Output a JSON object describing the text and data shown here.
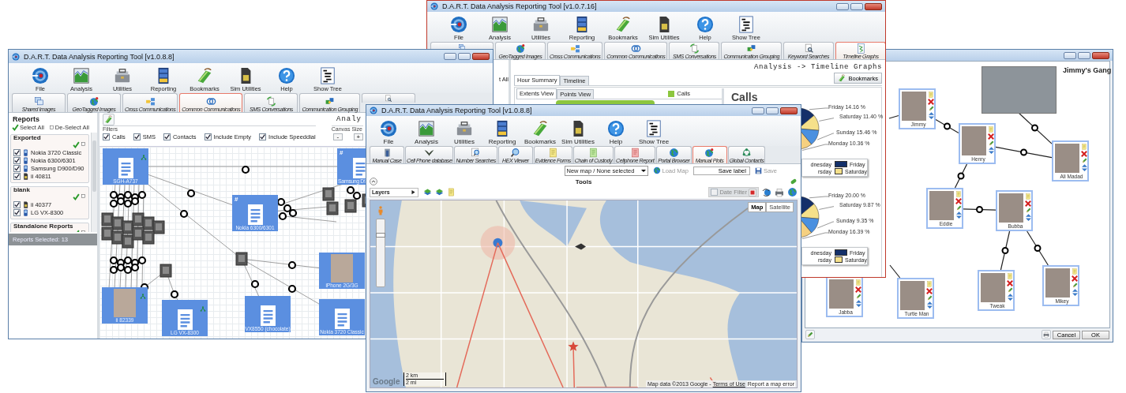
{
  "graph_window": {
    "title": "D.A.R.T. Data Analysis Reporting Tool [v1.0.8.8]",
    "toolbar": [
      "File",
      "Analysis",
      "Utilities",
      "Reporting",
      "Bookmarks",
      "Sim Utilities",
      "Help",
      "Show Tree"
    ],
    "tabs": [
      {
        "label": "Shared Images",
        "selected": false
      },
      {
        "label": "GeoTagged Images",
        "selected": false
      },
      {
        "label": "Cross Communications",
        "selected": false
      },
      {
        "label": "Common Communications",
        "selected": true
      },
      {
        "label": "SMS Conversations",
        "selected": false
      },
      {
        "label": "Communication Grouping",
        "selected": false
      },
      {
        "selected": false
      }
    ],
    "reports": {
      "title": "Reports",
      "select_all": "Select All",
      "deselect_all": "De-Select All",
      "groups": [
        {
          "name": "Exported",
          "items": [
            {
              "label": "Nokia 3720 Classic",
              "checked": true,
              "kind": "phone"
            },
            {
              "label": "Nokia 6300/6301",
              "checked": true,
              "kind": "phone"
            },
            {
              "label": "Samsung D900/D90",
              "checked": true,
              "kind": "phone"
            },
            {
              "label": "ii 40811",
              "checked": true,
              "kind": "sim"
            }
          ]
        },
        {
          "name": "blank",
          "items": [
            {
              "label": "ii 40377",
              "checked": true,
              "kind": "sim"
            },
            {
              "label": "LG VX-8300",
              "checked": true,
              "kind": "phone"
            }
          ]
        },
        {
          "name": "Standalone Reports"
        }
      ],
      "status": "Reports Selected: 13"
    },
    "breadcrumb": "Analy",
    "filters": {
      "title": "Filters",
      "items": [
        {
          "label": "Calls",
          "checked": true
        },
        {
          "label": "SMS",
          "checked": true
        },
        {
          "label": "Contacts",
          "checked": true
        },
        {
          "label": "Include Empty",
          "checked": true
        },
        {
          "label": "Include Speeddial",
          "checked": true
        }
      ]
    },
    "canvas_size": {
      "title": "Canvas Size",
      "buttons": [
        "-",
        "+"
      ]
    },
    "nodes": [
      {
        "label": "SGH-A737",
        "kind": "document",
        "tagged": true
      },
      {
        "label": "Nokia 6300/6301",
        "kind": "document",
        "mark": "#",
        "tagged": false
      },
      {
        "label": "Samsung D9",
        "kind": "document",
        "mark": "#",
        "tagged": false
      },
      {
        "label": "iPhone 2G/3G",
        "kind": "photo",
        "tagged": false
      },
      {
        "label": "ii 82339",
        "kind": "photo",
        "tagged": true
      },
      {
        "label": "LG VX-8300",
        "kind": "document",
        "tagged": true
      },
      {
        "label": "VX8550 (chocolate)",
        "kind": "document",
        "tagged": false
      },
      {
        "label": "Nokia 3720 Classic",
        "kind": "document",
        "tagged": false
      }
    ]
  },
  "timeline_window": {
    "title": "D.A.R.T. Data Analysis Reporting Tool [v1.0.7.16]",
    "toolbar": [
      "File",
      "Analysis",
      "Utilities",
      "Reporting",
      "Bookmarks",
      "Sim Utilities",
      "Help",
      "Show Tree"
    ],
    "tabs": [
      {
        "selected": false
      },
      {
        "label": "GeoTagged Images",
        "selected": false
      },
      {
        "label": "Cross Communications",
        "selected": false
      },
      {
        "label": "Common Communications",
        "selected": false
      },
      {
        "label": "SMS Conversations",
        "selected": false
      },
      {
        "label": "Communication Grouping",
        "selected": false
      },
      {
        "label": "Keyword Searches",
        "selected": false
      },
      {
        "label": "Timeline Graphs",
        "selected": true
      }
    ],
    "side_text": "t All",
    "breadcrumb": "Analysis -> Timeline Graphs",
    "bookmarks_button": "Bookmarks",
    "view_tabs": [
      {
        "label": "Hour Summary",
        "selected": true
      },
      {
        "label": "Timeline",
        "selected": false
      }
    ],
    "sub_tabs": [
      {
        "label": "Extents View",
        "selected": true
      },
      {
        "label": "Points View",
        "selected": false
      }
    ],
    "series_legend": "Calls",
    "panel_title": "Calls",
    "pies": [
      {
        "labels": [
          "Friday 14.16 %",
          "Saturday 11.40 %",
          "Sunday 15.46 %",
          "Monday 10.36 %"
        ],
        "legend": [
          {
            "label": "dnesday"
          },
          {
            "label": "Friday",
            "color": "#14306a"
          },
          {
            "label": "rsday"
          },
          {
            "label": "Saturday",
            "color": "#f5e08a"
          }
        ]
      },
      {
        "labels": [
          "Friday 20.00 %",
          "Saturday 9.87 %",
          "Sunday 9.35 %",
          "Monday 16.39 %"
        ],
        "legend": [
          {
            "label": "dnesday"
          },
          {
            "label": "Friday",
            "color": "#14306a"
          },
          {
            "label": "rsday"
          },
          {
            "label": "Saturday",
            "color": "#f5e08a"
          }
        ]
      }
    ]
  },
  "map_window": {
    "title": "D.A.R.T. Data Analysis Reporting Tool [v1.0.8.8]",
    "toolbar": [
      "File",
      "Analysis",
      "Utilities",
      "Reporting",
      "Bookmarks",
      "Sim Utilities",
      "Help",
      "Show Tree"
    ],
    "tabs": [
      {
        "label": "Manual Case",
        "selected": false
      },
      {
        "label": "Cell Phone database",
        "selected": false
      },
      {
        "label": "Number Searches",
        "selected": false
      },
      {
        "label": "HEX Viewer",
        "selected": false
      },
      {
        "label": "Evidence Forms",
        "selected": false
      },
      {
        "label": "Chain of Custody",
        "selected": false
      },
      {
        "label": "Cellphone Report",
        "selected": false
      },
      {
        "label": "Portal Browser",
        "selected": false
      },
      {
        "label": "Manual Plots",
        "selected": true
      },
      {
        "label": "Global Contacts",
        "selected": false
      }
    ],
    "map_selector": "New map / None selected",
    "load_map": {
      "label": "Load Map",
      "disabled": true
    },
    "save_label": "Save label",
    "save": {
      "label": "Save",
      "disabled": true
    },
    "tools_title": "Tools",
    "layers": "Layers",
    "date_filter": {
      "label": "Date Filter",
      "checked": false,
      "disabled": true
    },
    "zoom": {
      "level": 0.75
    },
    "map_types": [
      {
        "label": "Map",
        "selected": true
      },
      {
        "label": "Satellite",
        "selected": false
      }
    ],
    "scale": [
      "2 km",
      "2 mi"
    ],
    "logo": "Google",
    "attribution": "Map data ©2013 Google -",
    "terms": "Terms of Use",
    "report_error": "Report a map error"
  },
  "gang_window": {
    "title": "Jimmy's Gang",
    "people": [
      {
        "name": "Jimmy"
      },
      {
        "name": "Henry"
      },
      {
        "name": "Ali Madad"
      },
      {
        "name": "Eddie"
      },
      {
        "name": "Bubba"
      },
      {
        "name": "Jabba"
      },
      {
        "name": "Turtle Man"
      },
      {
        "name": "Tweak"
      },
      {
        "name": "Mikey"
      }
    ],
    "buttons": [
      "Cancel",
      "OK"
    ]
  }
}
